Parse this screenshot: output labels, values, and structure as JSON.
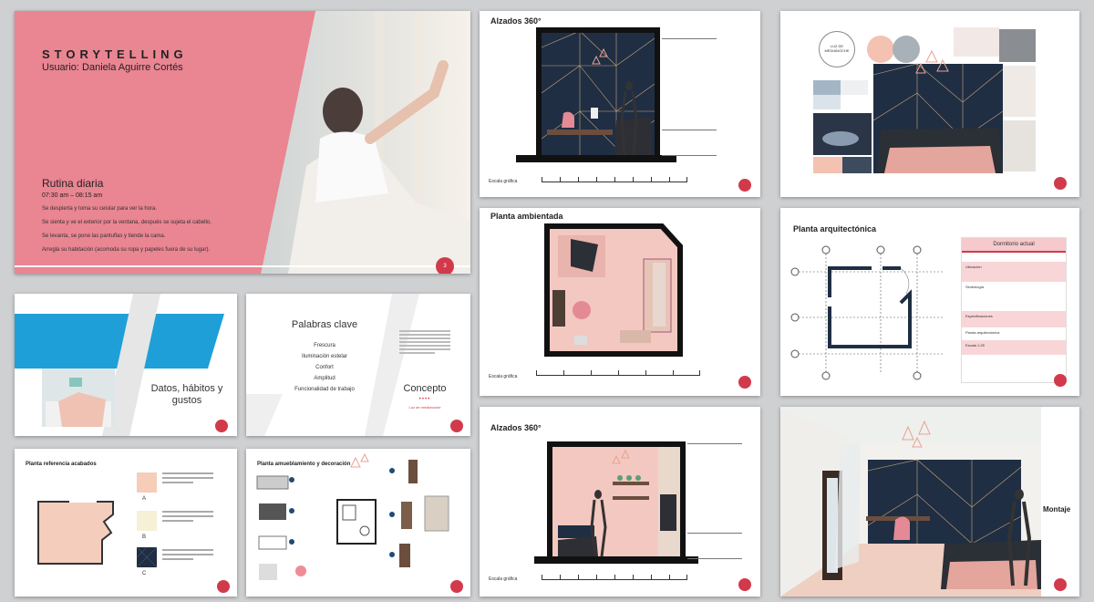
{
  "colors": {
    "pink": "#ef7f8f",
    "navy": "#1f2e43",
    "accent": "#d23a4c",
    "blue": "#1e9fd8",
    "blush": "#f3c8c0"
  },
  "slide1": {
    "title": "STORYTELLING",
    "user": "Usuario: Daniela Aguirre Cortés",
    "routine_title": "Rutina diaria",
    "time": "07:30 am – 08:15 am",
    "lines": [
      "Se despierta y toma su celular para ver la hora.",
      "Se sienta y ve el exterior por la ventana, después se sujeta el cabello.",
      "Se levanta, se pone las pantuflas y tiende la cama.",
      "Arregla su habitación (acomoda su ropa y papeles fuera de su lugar)."
    ],
    "page": "3"
  },
  "slide2": {
    "title": "Datos, hábitos y gustos"
  },
  "slide3": {
    "title": "Palabras clave",
    "keywords": [
      "Frescura",
      "Iluminación estelar",
      "Confort",
      "Amplitud",
      "Funcionalidad de trabajo"
    ],
    "concept": "Concepto",
    "concept_sub": "Luz de medianoche"
  },
  "slide4": {
    "title": "Planta referencia acabados",
    "labels": [
      "A",
      "B",
      "C"
    ]
  },
  "slide5": {
    "title": "Planta amueblamiento y decoración"
  },
  "slide6": {
    "title": "Alzados 360°",
    "scale": "Escala gráfica"
  },
  "slide7": {
    "title": "Planta ambientada",
    "scale": "Escala gráfica"
  },
  "slide8": {
    "title": "Alzados 360°",
    "scale": "Escala gráfica"
  },
  "slide9": {
    "circle_text": "LUZ DE MEDIANOCHE"
  },
  "slide10": {
    "title": "Planta arquitectónica",
    "panel_title": "Dormitorio actual",
    "ubicacion": "Ubicación",
    "simbologia": "Simbología",
    "especificaciones": "Especificaciones",
    "planta": "Planta arquitectónica",
    "escala": "Escala 1:25"
  },
  "slide11": {
    "label": "Montaje"
  }
}
